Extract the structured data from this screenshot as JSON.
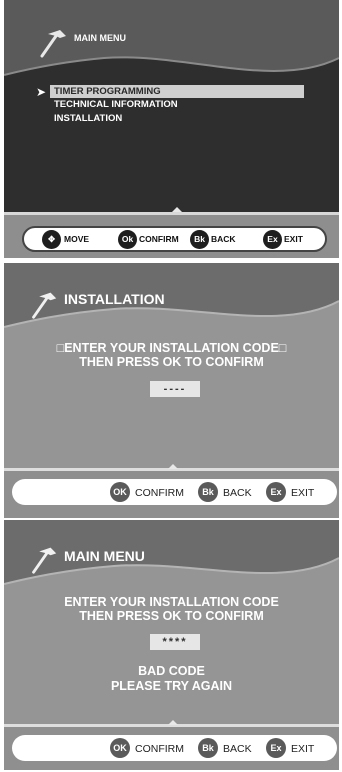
{
  "screen1": {
    "title": "MAIN MENU",
    "cursor_glyph": "➤",
    "menu": [
      "TIMER PROGRAMMING",
      "TECHNICAL INFORMATION",
      "INSTALLATION"
    ],
    "buttons": [
      {
        "key": "✥",
        "label": "MOVE"
      },
      {
        "key": "Ok",
        "label": "CONFIRM"
      },
      {
        "key": "Bk",
        "label": "BACK"
      },
      {
        "key": "Ex",
        "label": "EXIT"
      }
    ]
  },
  "screen2": {
    "title": "INSTALLATION",
    "line1": "□ENTER YOUR INSTALLATION CODE□",
    "line2": "THEN PRESS OK TO CONFIRM",
    "code": "----",
    "buttons": [
      {
        "key": "OK",
        "label": "CONFIRM"
      },
      {
        "key": "Bk",
        "label": "BACK"
      },
      {
        "key": "Ex",
        "label": "EXIT"
      }
    ]
  },
  "screen3": {
    "title": "MAIN MENU",
    "line1": "ENTER YOUR INSTALLATION CODE",
    "line2": "THEN PRESS OK TO CONFIRM",
    "code": "****",
    "error1": "BAD CODE",
    "error2": "PLEASE TRY AGAIN",
    "buttons": [
      {
        "key": "OK",
        "label": "CONFIRM"
      },
      {
        "key": "Bk",
        "label": "BACK"
      },
      {
        "key": "Ex",
        "label": "EXIT"
      }
    ]
  }
}
